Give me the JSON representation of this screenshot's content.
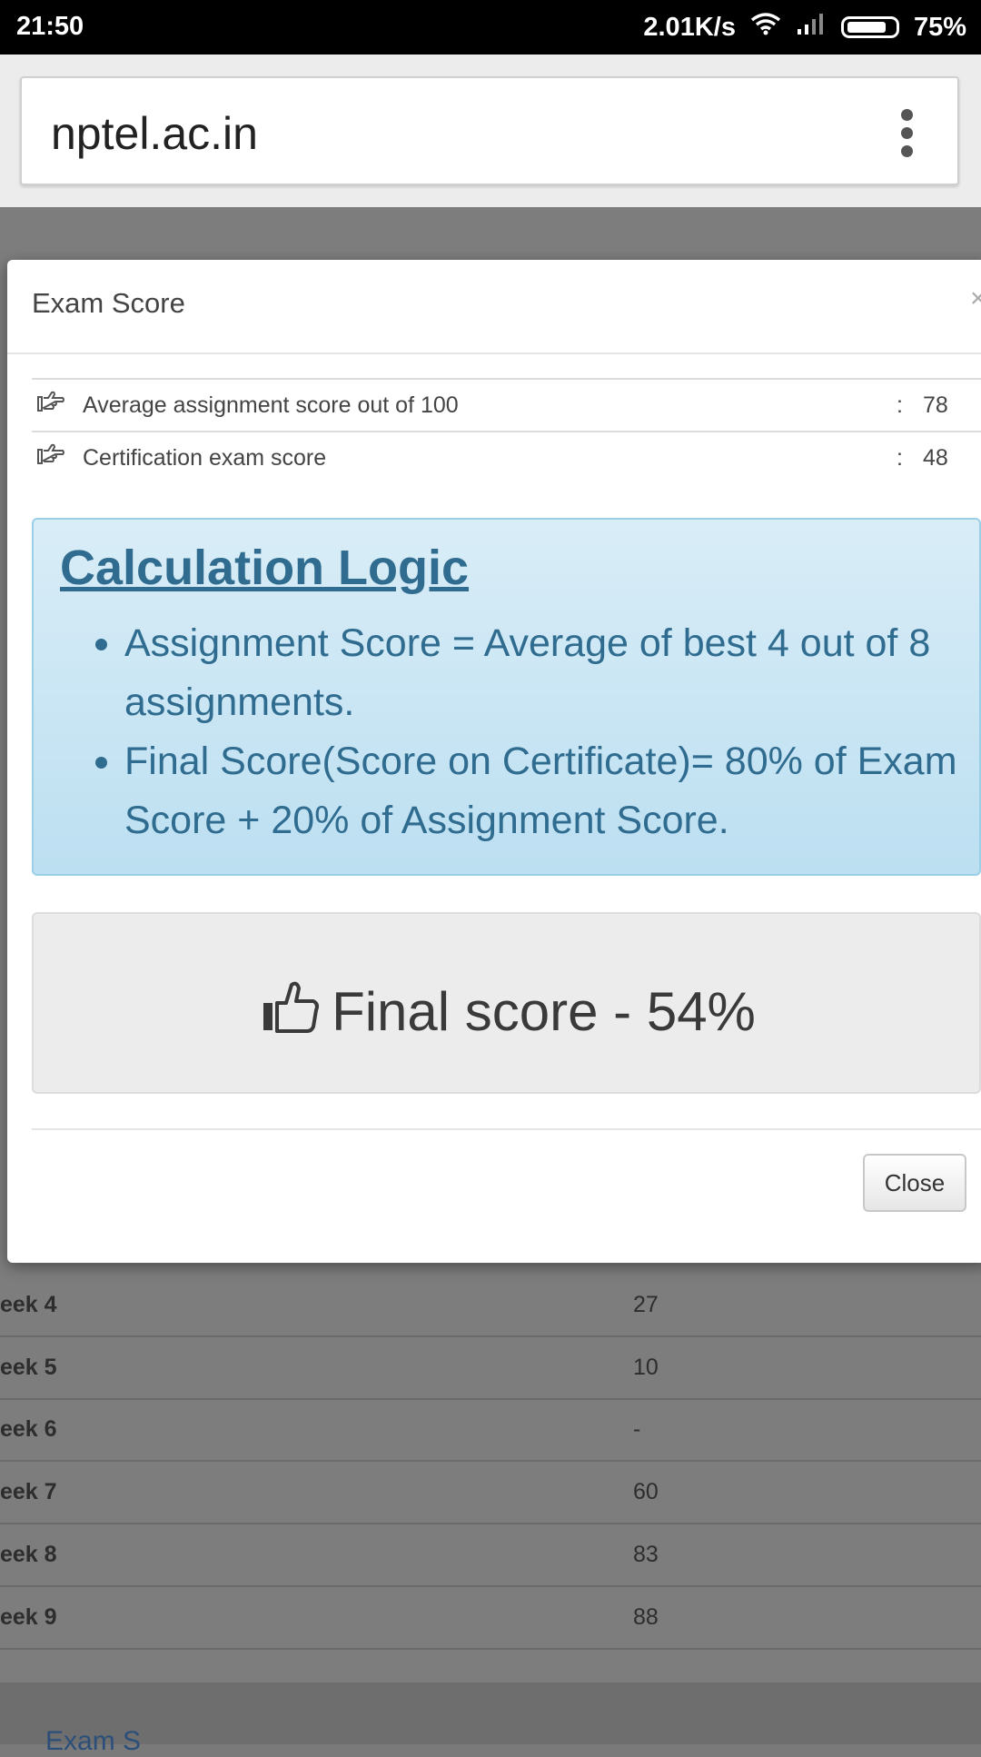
{
  "status_bar": {
    "time": "21:50",
    "network_speed": "2.01K/s",
    "battery": "75%"
  },
  "browser": {
    "url": "nptel.ac.in"
  },
  "modal": {
    "title": "Exam Score",
    "close_x": "×",
    "rows": [
      {
        "label": "Average assignment score out of 100",
        "colon": ":",
        "value": "78"
      },
      {
        "label": "Certification exam score",
        "colon": ":",
        "value": "48"
      }
    ],
    "logic": {
      "title": "Calculation Logic",
      "items": [
        "Assignment Score = Average of best 4 out of 8 assignments.",
        "Final Score(Score on Certificate)= 80% of Exam Score + 20% of Assignment Score."
      ]
    },
    "final_score": "Final score - 54%",
    "close_button": "Close"
  },
  "background_table": {
    "rows": [
      {
        "week": "eek 4",
        "score": "27"
      },
      {
        "week": "eek 5",
        "score": "10"
      },
      {
        "week": "eek 6",
        "score": "-"
      },
      {
        "week": "eek 7",
        "score": "60"
      },
      {
        "week": "eek 8",
        "score": "83"
      },
      {
        "week": "eek 9",
        "score": "88"
      }
    ],
    "footer_link": "Exam S"
  },
  "colors": {
    "logic_text": "#2f6c8f",
    "logic_bg": "#d9edf7",
    "overlay": "#7d7d7d"
  },
  "icons": [
    "wifi-icon",
    "signal-icon",
    "battery-icon",
    "menu-dots-icon",
    "hand-point-right-icon",
    "thumbs-up-icon"
  ]
}
